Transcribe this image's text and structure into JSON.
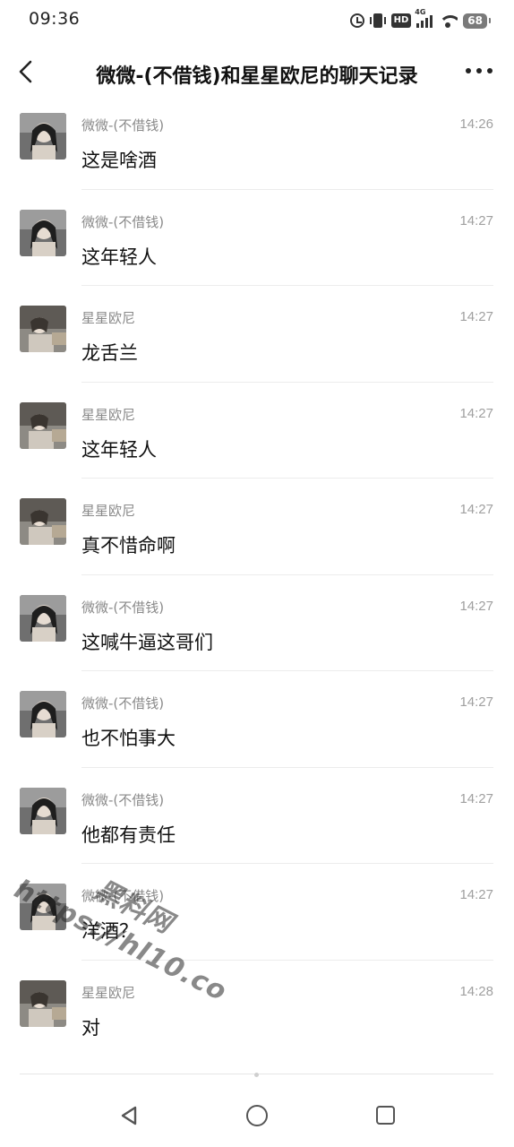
{
  "status_bar": {
    "time": "09:36",
    "network_tag": "4G",
    "hd_label": "HD",
    "battery": "68"
  },
  "header": {
    "title": "微微-(不借钱)和星星欧尼的聊天记录"
  },
  "messages": [
    {
      "sender": "微微-(不借钱)",
      "time": "14:26",
      "text": "这是啥酒"
    },
    {
      "sender": "微微-(不借钱)",
      "time": "14:27",
      "text": "这年轻人"
    },
    {
      "sender": "星星欧尼",
      "time": "14:27",
      "text": "龙舌兰"
    },
    {
      "sender": "星星欧尼",
      "time": "14:27",
      "text": "这年轻人"
    },
    {
      "sender": "星星欧尼",
      "time": "14:27",
      "text": "真不惜命啊"
    },
    {
      "sender": "微微-(不借钱)",
      "time": "14:27",
      "text": "这喊牛逼这哥们"
    },
    {
      "sender": "微微-(不借钱)",
      "time": "14:27",
      "text": "也不怕事大"
    },
    {
      "sender": "微微-(不借钱)",
      "time": "14:27",
      "text": "他都有责任"
    },
    {
      "sender": "微微-(不借钱)",
      "time": "14:27",
      "text": "洋酒？"
    },
    {
      "sender": "星星欧尼",
      "time": "14:28",
      "text": "对"
    }
  ],
  "watermark": {
    "line1": "黑料网",
    "line2": "https://hl10.co"
  },
  "colors": {
    "background": "#ffffff",
    "sender": "#8a8a8a",
    "timestamp": "#a0a0a0",
    "divider": "#ececec"
  }
}
